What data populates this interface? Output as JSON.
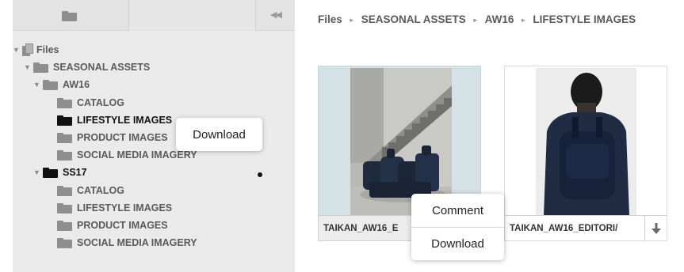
{
  "toolbar": {
    "folder_icon": "folder-icon",
    "collapse_icon": "double-left-arrow-icon",
    "collapse_glyph": "◀◀"
  },
  "tree": {
    "root": {
      "label": "Files",
      "caret": "▼",
      "icon": "files-stack-icon"
    },
    "items": [
      {
        "label": "SEASONAL ASSETS",
        "caret": "▼"
      },
      {
        "label": "AW16",
        "caret": "▼"
      },
      {
        "label": "CATALOG"
      },
      {
        "label": "LIFESTYLE IMAGES",
        "active": true
      },
      {
        "label": "PRODUCT IMAGES"
      },
      {
        "label": "SOCIAL MEDIA IMAGERY"
      },
      {
        "label": "SS17",
        "caret": "▼",
        "active": true
      },
      {
        "label": "CATALOG"
      },
      {
        "label": "LIFESTYLE IMAGES"
      },
      {
        "label": "PRODUCT IMAGES"
      },
      {
        "label": "SOCIAL MEDIA IMAGERY"
      }
    ]
  },
  "context_menu_left": {
    "download_label": "Download"
  },
  "breadcrumb": {
    "items": [
      "Files",
      "SEASONAL ASSETS",
      "AW16",
      "LIFESTYLE IMAGES"
    ],
    "separator": "►"
  },
  "assets": [
    {
      "caption": "TAIKAN_AW16_E",
      "selected": true
    },
    {
      "caption": "TAIKAN_AW16_EDITORI/",
      "action_icon": "download-arrow-icon"
    }
  ],
  "context_menu_right": {
    "comment_label": "Comment",
    "download_label": "Download"
  },
  "colors": {
    "panel_bg": "#eaeaea",
    "selected_card_bg": "#d4e2e6",
    "text_bold": "#5a5a5a",
    "active_text": "#111111"
  }
}
